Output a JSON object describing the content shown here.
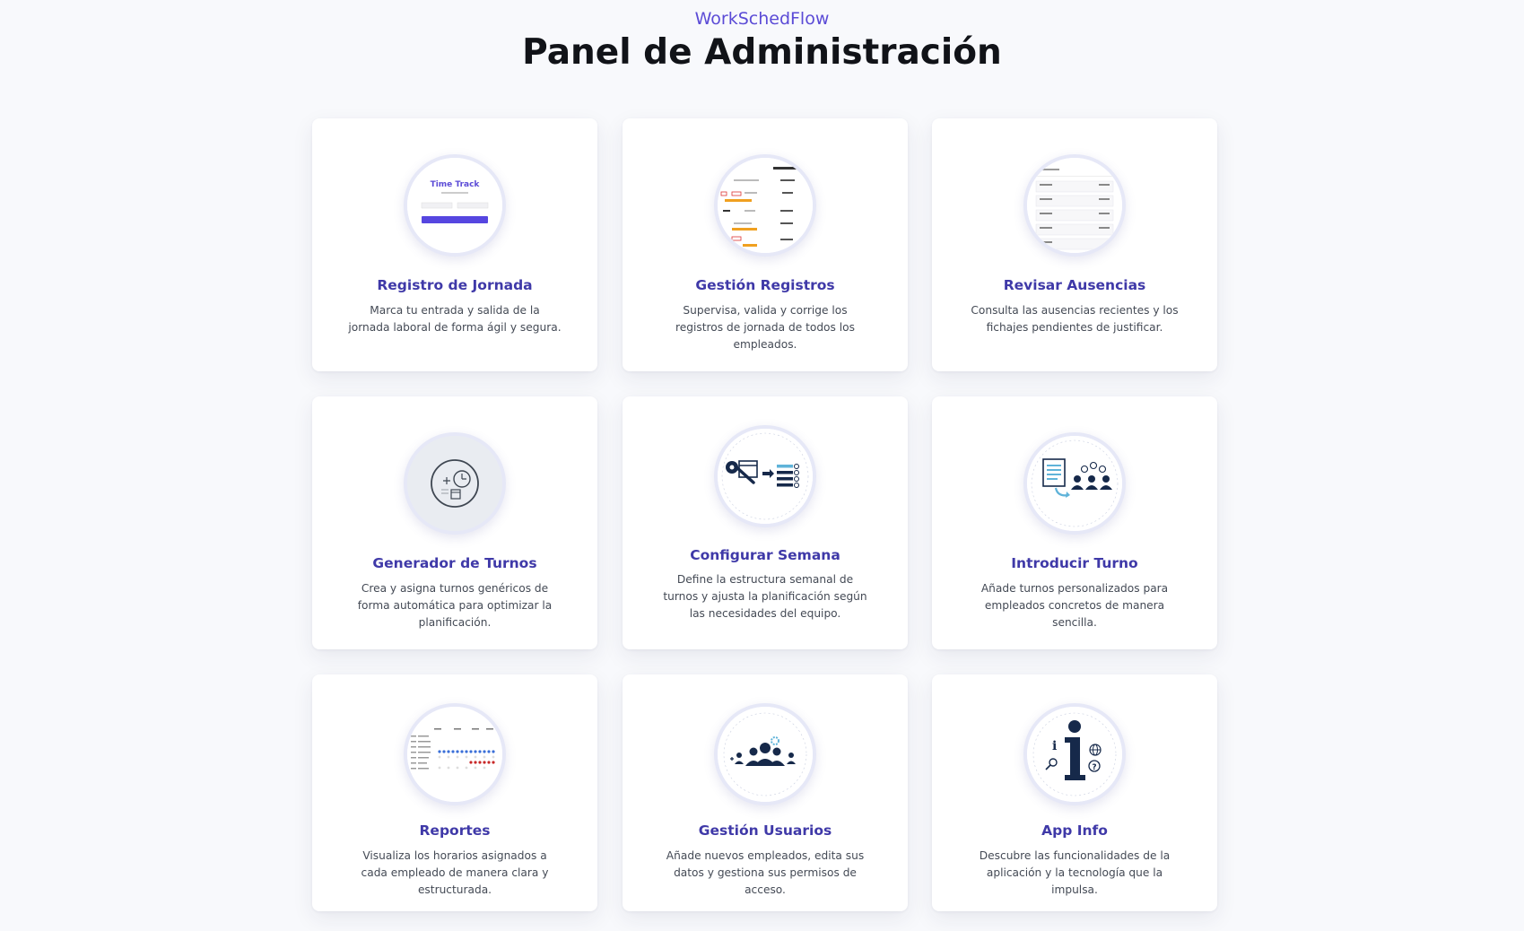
{
  "header": {
    "brand": "WorkSchedFlow",
    "title": "Panel de Administración"
  },
  "cards": [
    {
      "title": "Registro de Jornada",
      "description": "Marca tu entrada y salida de la jornada laboral de forma ágil y segura.",
      "thumb_text": "Time Track",
      "icon": "time-track-screenshot"
    },
    {
      "title": "Gestión Registros",
      "description": "Supervisa, valida y corrige los registros de jornada de todos los empleados.",
      "icon": "records-table-screenshot"
    },
    {
      "title": "Revisar Ausencias",
      "description": "Consulta las ausencias recientes y los fichajes pendientes de justificar.",
      "icon": "absences-list-screenshot"
    },
    {
      "title": "Generador de Turnos",
      "description": "Crea y asigna turnos genéricos de forma automática para optimizar la planificación.",
      "icon": "clock-calendar-icon"
    },
    {
      "title": "Configurar Semana",
      "description": "Define la estructura semanal de turnos y ajusta la planificación según las necesidades del equipo.",
      "icon": "wrench-gear-schedule-icon"
    },
    {
      "title": "Introducir Turno",
      "description": "Añade turnos personalizados para empleados concretos de manera sencilla.",
      "icon": "document-assign-team-icon"
    },
    {
      "title": "Reportes",
      "description": "Visualiza los horarios asignados a cada empleado de manera clara y estructurada.",
      "icon": "schedule-report-screenshot"
    },
    {
      "title": "Gestión Usuarios",
      "description": "Añade nuevos empleados, edita sus datos y gestiona sus permisos de acceso.",
      "icon": "users-group-icon"
    },
    {
      "title": "App Info",
      "description": "Descubre las funcionalidades de la aplicación y la tecnología que la impulsa.",
      "icon": "info-icon"
    }
  ],
  "colors": {
    "accent": "#5b4bd6",
    "title": "#3f39a8",
    "navy": "#16294a",
    "background": "#f8f9fc"
  }
}
